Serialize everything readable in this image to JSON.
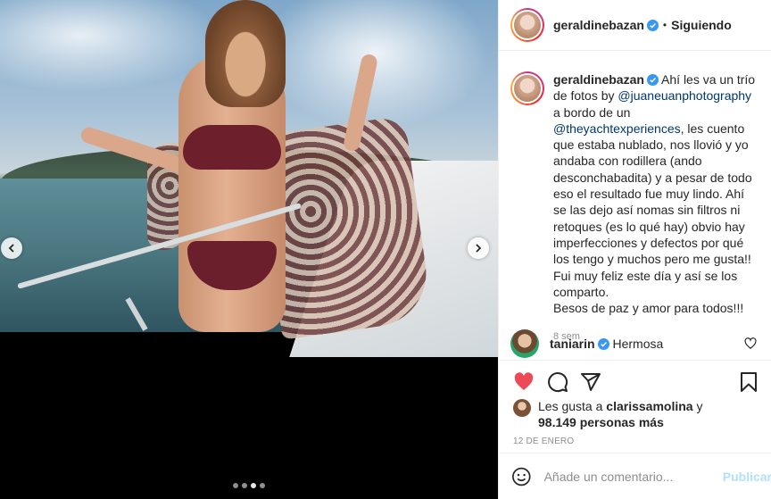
{
  "post": {
    "username": "geraldinebazan",
    "separator": "•",
    "follow_status": "Siguiendo"
  },
  "caption": {
    "username": "geraldinebazan",
    "part1": " Ahí les va un trío de fotos by ",
    "mention1": "@juaneuanphotography",
    "part2": " a bordo de un ",
    "mention2": "@theyachtexperiences",
    "part3": ", les cuento que estaba nublado, nos llovió y yo andaba con rodillera (ando desconchabadita) y a pesar de todo eso el resultado fue muy lindo. Ahí se las dejo así nomas sin filtros ni retoques (es lo qué hay) obvio hay imperfecciones y defectos por qué los tengo y muchos pero me gusta!!",
    "line2": "Fui muy feliz este día y así se los comparto.",
    "line3": "Besos de paz y amor para todos!!!",
    "time": "8 sem"
  },
  "comment": {
    "username": "taniarin",
    "text": "Hermosa"
  },
  "likes": {
    "prefix": "Les gusta a ",
    "user": "clarissamolina",
    "middle": " y",
    "count": "98.149 personas más"
  },
  "date": "12 DE ENERO",
  "add_comment": {
    "placeholder": "Añade un comentario...",
    "publish": "Publicar"
  },
  "colors": {
    "like_red": "#ed4956",
    "link_blue": "#00376b",
    "verified_blue": "#3897f0",
    "publish_disabled": "#b2dffc"
  },
  "carousel": {
    "count": 4,
    "active": 2
  }
}
